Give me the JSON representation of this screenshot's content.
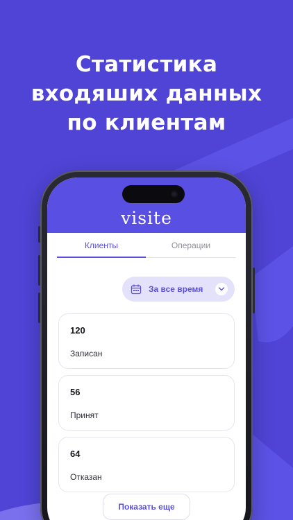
{
  "promo": {
    "headline_lines": [
      "Статистика",
      "входяших данных",
      "по клиентам"
    ]
  },
  "app": {
    "logo_text": "visite",
    "tabs": [
      {
        "label": "Клиенты",
        "active": true
      },
      {
        "label": "Операции",
        "active": false
      }
    ],
    "period_filter": {
      "label": "За все время"
    },
    "stats": [
      {
        "value": "120",
        "label": "Записан"
      },
      {
        "value": "56",
        "label": "Принят"
      },
      {
        "value": "64",
        "label": "Отказан"
      }
    ],
    "show_more_label": "Показать еще"
  },
  "icons": {
    "period": "calendar-icon",
    "period_toggle": "chevron-down-icon"
  },
  "colors": {
    "background": "#4f44d6",
    "accent": "#5a4fe3",
    "chip_background": "#e4e2fb",
    "card_border": "#e6e6ee"
  }
}
